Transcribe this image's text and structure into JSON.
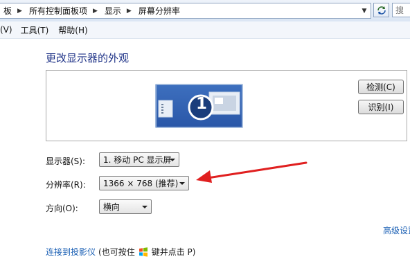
{
  "address_bar": {
    "crumbs": [
      "板",
      "所有控制面板项",
      "显示",
      "屏幕分辨率"
    ],
    "search_placeholder": "搜"
  },
  "menu": {
    "items": [
      "(V)",
      "工具(T)",
      "帮助(H)"
    ]
  },
  "page": {
    "title": "更改显示器的外观",
    "monitor_number": "1",
    "detect_button": "检测(C)",
    "identify_button": "识别(I)"
  },
  "settings": {
    "display_label": "显示器(S):",
    "display_value": "1. 移动 PC 显示屏",
    "resolution_label": "分辨率(R):",
    "resolution_value": "1366 × 768 (推荐)",
    "orientation_label": "方向(O):",
    "orientation_value": "横向"
  },
  "links": {
    "advanced": "高级设置",
    "connect_projector": "连接到投影仪",
    "hint_before": "(也可按住",
    "hint_after": "键并点击 P)"
  },
  "colors": {
    "link": "#1a5fb4",
    "title": "#1e3287",
    "monitor_blue": "#2a57a8",
    "annotation_arrow": "#e02020"
  }
}
